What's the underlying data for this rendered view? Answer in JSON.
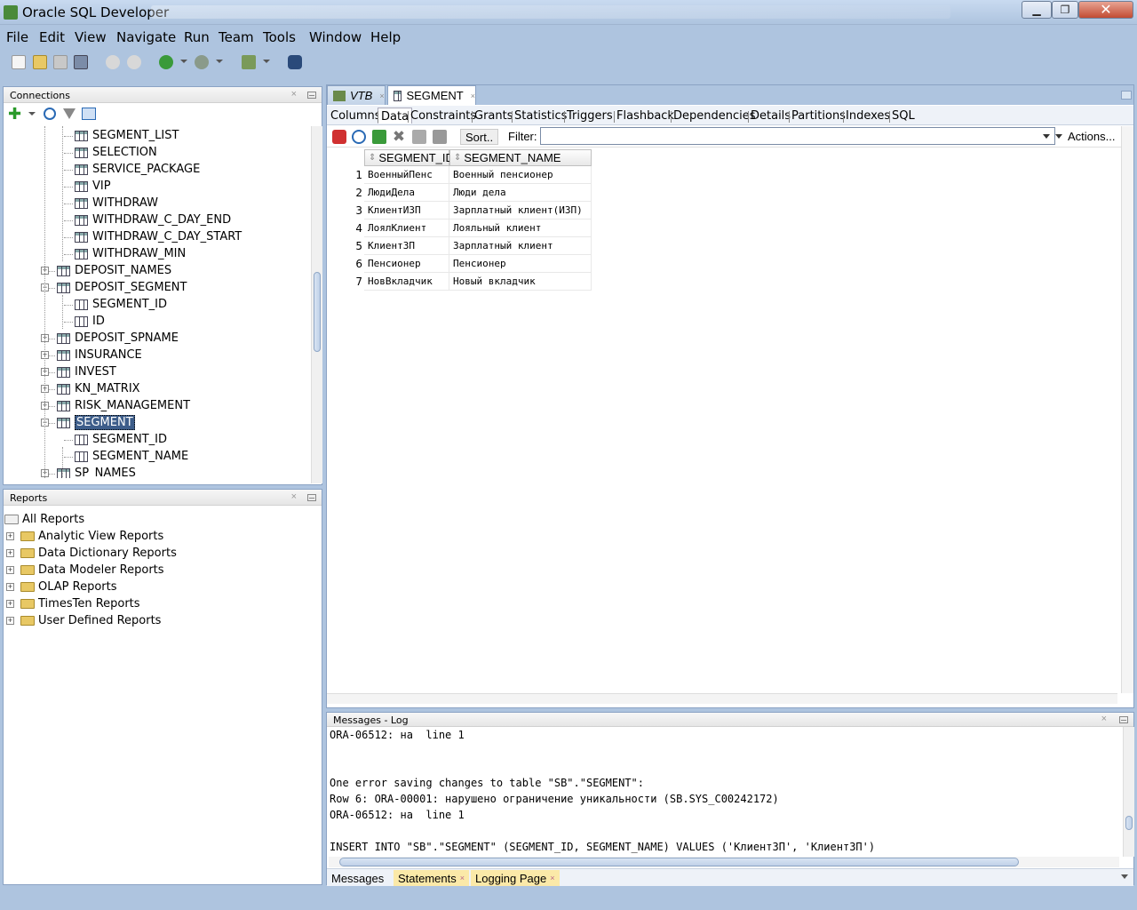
{
  "window": {
    "title": "Oracle SQL Developer",
    "min_label": "▁",
    "max_label": "❐",
    "close_label": "✕"
  },
  "menu": [
    "File",
    "Edit",
    "View",
    "Navigate",
    "Run",
    "Team",
    "Tools",
    "Window",
    "Help"
  ],
  "toolbar": {
    "icons": [
      "new-icon",
      "open-icon",
      "save-icon",
      "save-all-icon",
      "undo-icon",
      "redo-icon",
      "back-icon",
      "forward-icon",
      "sql-worksheet-icon",
      "find-db-object-icon"
    ]
  },
  "connections": {
    "title": "Connections",
    "close": "×",
    "tree": [
      {
        "label": "SEGMENT_LIST",
        "type": "table",
        "level": 2
      },
      {
        "label": "SELECTION",
        "type": "table",
        "level": 2
      },
      {
        "label": "SERVICE_PACKAGE",
        "type": "table",
        "level": 2
      },
      {
        "label": "VIP",
        "type": "table",
        "level": 2
      },
      {
        "label": "WITHDRAW",
        "type": "table",
        "level": 2
      },
      {
        "label": "WITHDRAW_C_DAY_END",
        "type": "table",
        "level": 2
      },
      {
        "label": "WITHDRAW_C_DAY_START",
        "type": "table",
        "level": 2
      },
      {
        "label": "WITHDRAW_MIN",
        "type": "table",
        "level": 2
      },
      {
        "label": "DEPOSIT_NAMES",
        "type": "table",
        "level": 1,
        "expander": "+"
      },
      {
        "label": "DEPOSIT_SEGMENT",
        "type": "table",
        "level": 1,
        "expander": "-"
      },
      {
        "label": "SEGMENT_ID",
        "type": "column",
        "level": 2
      },
      {
        "label": "ID",
        "type": "column",
        "level": 2
      },
      {
        "label": "DEPOSIT_SPNAME",
        "type": "table",
        "level": 1,
        "expander": "+"
      },
      {
        "label": "INSURANCE",
        "type": "table",
        "level": 1,
        "expander": "+"
      },
      {
        "label": "INVEST",
        "type": "table",
        "level": 1,
        "expander": "+"
      },
      {
        "label": "KN_MATRIX",
        "type": "table",
        "level": 1,
        "expander": "+"
      },
      {
        "label": "RISK_MANAGEMENT",
        "type": "table",
        "level": 1,
        "expander": "+"
      },
      {
        "label": "SEGMENT",
        "type": "table",
        "level": 1,
        "expander": "-",
        "selected": true
      },
      {
        "label": "SEGMENT_ID",
        "type": "column",
        "level": 2
      },
      {
        "label": "SEGMENT_NAME",
        "type": "column",
        "level": 2
      },
      {
        "label": "SP_NAMES",
        "type": "table",
        "level": 1,
        "expander": "+"
      }
    ]
  },
  "reports": {
    "title": "Reports",
    "close": "×",
    "root": "All Reports",
    "items": [
      "Analytic View Reports",
      "Data Dictionary Reports",
      "Data Modeler Reports",
      "OLAP Reports",
      "TimesTen Reports",
      "User Defined Reports"
    ]
  },
  "editor": {
    "tabs": [
      {
        "label": "VTB",
        "close": "×"
      },
      {
        "label": "SEGMENT",
        "close": "×"
      }
    ],
    "subtabs": [
      "Columns",
      "Data",
      "Constraints",
      "Grants",
      "Statistics",
      "Triggers",
      "Flashback",
      "Dependencies",
      "Details",
      "Partitions",
      "Indexes",
      "SQL"
    ],
    "active_subtab": "Data",
    "sort_label": "Sort..",
    "filter_label": "Filter:",
    "filter_value": "",
    "actions_label": "Actions...",
    "columns": [
      "SEGMENT_ID",
      "SEGMENT_NAME"
    ],
    "rows": [
      {
        "n": "1",
        "id": "ВоенныйПенс",
        "name": "Военный пенсионер"
      },
      {
        "n": "2",
        "id": "ЛюдиДела",
        "name": "Люди дела"
      },
      {
        "n": "3",
        "id": "КлиентИЗП",
        "name": "Зарплатный клиент(ИЗП)"
      },
      {
        "n": "4",
        "id": "ЛоялКлиент",
        "name": "Лояльный клиент"
      },
      {
        "n": "5",
        "id": "КлиентЗП",
        "name": "Зарплатный клиент"
      },
      {
        "n": "6",
        "id": "Пенсионер",
        "name": "Пенсионер"
      },
      {
        "n": "7",
        "id": "НовВкладчик",
        "name": "Новый вкладчик"
      }
    ]
  },
  "messages": {
    "title": "Messages - Log",
    "close": "×",
    "log": "ORA-06512: на  line 1\n\n\nOne error saving changes to table \"SB\".\"SEGMENT\":\nRow 6: ORA-00001: нарушено ограничение уникальности (SB.SYS_C00242172)\nORA-06512: на  line 1\n\nINSERT INTO \"SB\".\"SEGMENT\" (SEGMENT_ID, SEGMENT_NAME) VALUES ('КлиентЗП', 'КлиентЗП')",
    "tabs": [
      {
        "label": "Messages",
        "close": ""
      },
      {
        "label": "Statements",
        "close": "×"
      },
      {
        "label": "Logging Page",
        "close": "×"
      }
    ]
  }
}
